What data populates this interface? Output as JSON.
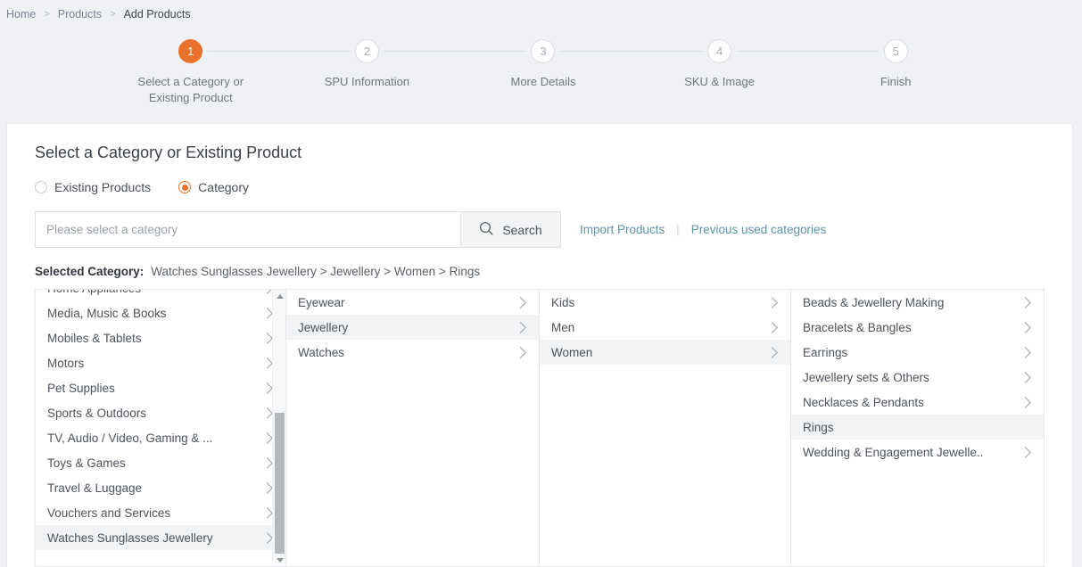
{
  "breadcrumb": {
    "items": [
      {
        "label": "Home",
        "current": false
      },
      {
        "label": "Products",
        "current": false
      },
      {
        "label": "Add Products",
        "current": true
      }
    ],
    "separator": ">"
  },
  "stepper": {
    "steps": [
      {
        "num": "1",
        "label": "Select a Category or Existing Product",
        "active": true
      },
      {
        "num": "2",
        "label": "SPU Information",
        "active": false
      },
      {
        "num": "3",
        "label": "More Details",
        "active": false
      },
      {
        "num": "4",
        "label": "SKU & Image",
        "active": false
      },
      {
        "num": "5",
        "label": "Finish",
        "active": false
      }
    ],
    "active_color": "#e9712a"
  },
  "card": {
    "title": "Select a Category or Existing Product",
    "radios": [
      {
        "label": "Existing Products",
        "checked": false
      },
      {
        "label": "Category",
        "checked": true
      }
    ],
    "search": {
      "placeholder": "Please select a category",
      "value": "",
      "button_label": "Search",
      "button_icon": "search-icon"
    },
    "links": [
      {
        "label": "Import Products"
      },
      {
        "label": "Previous used categories"
      }
    ],
    "link_separator": "|",
    "link_color": "#5b93a8",
    "selected_category": {
      "label": "Selected Category:",
      "path": "Watches Sunglasses Jewellery > Jewellery > Women > Rings"
    }
  },
  "cascader": {
    "columns": [
      {
        "name": "column-root",
        "scrollable": true,
        "items": [
          {
            "label": "Home Appliances",
            "chevron": true,
            "selected": false
          },
          {
            "label": "Media, Music & Books",
            "chevron": true,
            "selected": false
          },
          {
            "label": "Mobiles & Tablets",
            "chevron": true,
            "selected": false
          },
          {
            "label": "Motors",
            "chevron": true,
            "selected": false
          },
          {
            "label": "Pet Supplies",
            "chevron": true,
            "selected": false
          },
          {
            "label": "Sports & Outdoors",
            "chevron": true,
            "selected": false
          },
          {
            "label": "TV, Audio / Video, Gaming & ...",
            "chevron": true,
            "selected": false
          },
          {
            "label": "Toys & Games",
            "chevron": true,
            "selected": false
          },
          {
            "label": "Travel & Luggage",
            "chevron": true,
            "selected": false
          },
          {
            "label": "Vouchers and Services",
            "chevron": true,
            "selected": false
          },
          {
            "label": "Watches Sunglasses Jewellery",
            "chevron": true,
            "selected": true
          }
        ]
      },
      {
        "name": "column-level2",
        "scrollable": false,
        "items": [
          {
            "label": "Eyewear",
            "chevron": true,
            "selected": false
          },
          {
            "label": "Jewellery",
            "chevron": true,
            "selected": true
          },
          {
            "label": "Watches",
            "chevron": true,
            "selected": false
          }
        ]
      },
      {
        "name": "column-level3",
        "scrollable": false,
        "items": [
          {
            "label": "Kids",
            "chevron": true,
            "selected": false
          },
          {
            "label": "Men",
            "chevron": true,
            "selected": false
          },
          {
            "label": "Women",
            "chevron": true,
            "selected": true
          }
        ]
      },
      {
        "name": "column-level4",
        "scrollable": false,
        "items": [
          {
            "label": "Beads & Jewellery Making",
            "chevron": true,
            "selected": false
          },
          {
            "label": "Bracelets & Bangles",
            "chevron": true,
            "selected": false
          },
          {
            "label": "Earrings",
            "chevron": true,
            "selected": false
          },
          {
            "label": "Jewellery sets & Others",
            "chevron": true,
            "selected": false
          },
          {
            "label": "Necklaces & Pendants",
            "chevron": true,
            "selected": false
          },
          {
            "label": "Rings",
            "chevron": false,
            "selected": true
          },
          {
            "label": "Wedding & Engagement Jewelle..",
            "chevron": true,
            "selected": false
          }
        ]
      }
    ]
  }
}
